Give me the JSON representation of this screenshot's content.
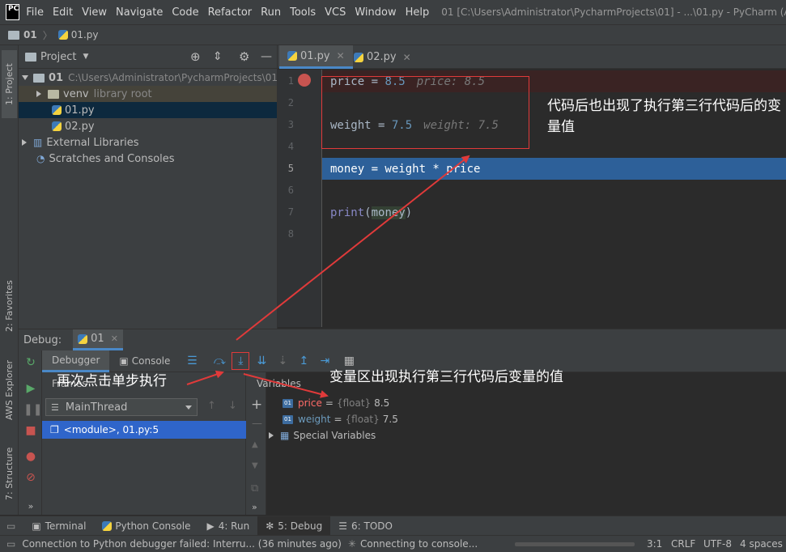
{
  "menubar": {
    "logo": "PC",
    "items": [
      "File",
      "Edit",
      "View",
      "Navigate",
      "Code",
      "Refactor",
      "Run",
      "Tools",
      "VCS",
      "Window",
      "Help"
    ],
    "window_title": "01 [C:\\Users\\Administrator\\PycharmProjects\\01] - ...\\01.py - PyCharm (Admin"
  },
  "navbar": {
    "project": "01",
    "file": "01.py"
  },
  "left_strip": {
    "project_tab": "1: Project",
    "favorites_tab": "2: Favorites",
    "aws_tab": "AWS Explorer",
    "structure_tab": "7: Structure"
  },
  "project": {
    "header": "Project",
    "root_name": "01",
    "root_path": "C:\\Users\\Administrator\\PycharmProjects\\01",
    "venv": "venv",
    "venv_hint": "library root",
    "file1": "01.py",
    "file2": "02.py",
    "external": "External Libraries",
    "scratches": "Scratches and Consoles"
  },
  "editor": {
    "tabs": [
      "01.py",
      "02.py"
    ],
    "line_numbers": [
      "1",
      "2",
      "3",
      "4",
      "5",
      "6",
      "7",
      "8"
    ],
    "line1_code": "price = ",
    "line1_num": "8.5",
    "line1_inline": "price: 8.5",
    "line3_code": "weight = ",
    "line3_num": "7.5",
    "line3_inline": "weight: 7.5",
    "line5_code": "money = weight * price",
    "line7_fn": "print",
    "line7_open": "(",
    "line7_arg": "money",
    "line7_close": ")"
  },
  "debug": {
    "label": "Debug:",
    "config": "01",
    "tab_debugger": "Debugger",
    "tab_console": "Console",
    "frames_label": "Frames",
    "variables_label": "Variables",
    "thread": "MainThread",
    "frame": "<module>, 01.py:5",
    "variables": [
      {
        "name": "price",
        "type": "{float}",
        "value": "8.5"
      },
      {
        "name": "weight",
        "type": "{float}",
        "value": "7.5"
      }
    ],
    "special": "Special Variables"
  },
  "bottom_tabs": {
    "terminal": "Terminal",
    "python_console": "Python Console",
    "run": "4: Run",
    "debug": "5: Debug",
    "todo": "6: TODO"
  },
  "status": {
    "message": "Connection to Python debugger failed: Interru... (36 minutes ago)",
    "connecting": "Connecting to console...",
    "position": "3:1",
    "line_sep": "CRLF",
    "encoding": "UTF-8",
    "indent": "4 spaces"
  },
  "annotations": {
    "top": "代码后也出现了执行第三行代码后的变量值",
    "left": "再次点击单步执行",
    "middle": "变量区出现执行第三行代码后变量的值"
  },
  "colors": {
    "accent": "#4a88c7",
    "annotation": "#e03a3a",
    "exec_line": "#2d6099"
  }
}
